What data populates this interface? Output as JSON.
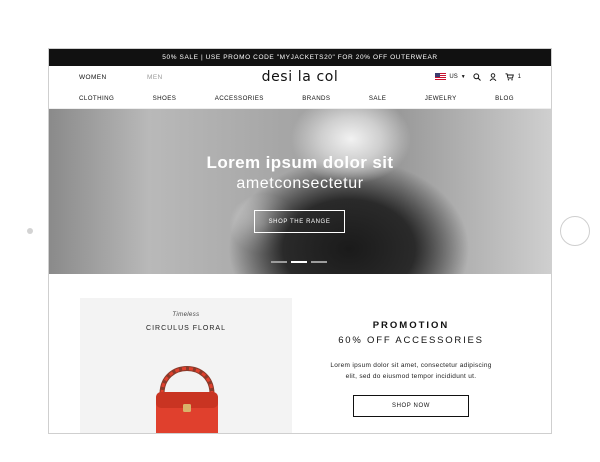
{
  "promo_bar": {
    "text": "50% SALE  |  USE PROMO CODE \"MYJACKETS20\" FOR 20% OFF OUTERWEAR"
  },
  "header": {
    "gender_tabs": [
      "WOMEN",
      "MEN"
    ],
    "logo": "desi la col",
    "locale": "US",
    "cart_count": "1",
    "icons": [
      "us-flag-icon",
      "search-icon",
      "account-icon",
      "cart-icon"
    ]
  },
  "nav": {
    "items": [
      "CLOTHING",
      "SHOES",
      "ACCESSORIES",
      "BRANDS",
      "SALE",
      "JEWELRY",
      "BLOG"
    ]
  },
  "hero": {
    "title": "Lorem ipsum dolor sit",
    "subtitle": "ametconsectetur",
    "button": "SHOP THE RANGE",
    "slides": 3,
    "active_slide": 2
  },
  "product": {
    "tag": "Timeless",
    "name": "CIRCULUS FLORAL"
  },
  "promotion": {
    "heading": "PROMOTION",
    "subheading": "60% OFF ACCESSORIES",
    "text_line1": "Lorem ipsum dolor sit amet, consectetur adipiscing",
    "text_line2": "elit, sed do eiusmod tempor incididunt ut.",
    "button": "SHOP NOW"
  },
  "colors": {
    "accent": "#111111",
    "bag": "#e0402d",
    "card_bg": "#f3f3f3"
  }
}
